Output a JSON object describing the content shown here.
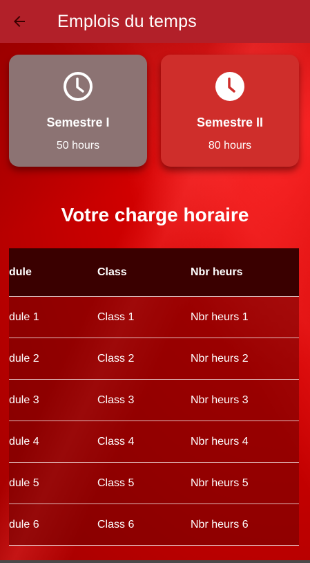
{
  "appbar": {
    "title": "Emplois du temps",
    "back_icon": "arrow-left-icon"
  },
  "cards": [
    {
      "name": "Semestre I",
      "hours": "50 hours",
      "icon": "clock-outline-icon",
      "color": "#8c7373"
    },
    {
      "name": "Semestre II",
      "hours": "80 hours",
      "icon": "clock-filled-icon",
      "color": "#cf2e2b"
    }
  ],
  "section_title": "Votre charge horaire",
  "table": {
    "headers": [
      "dule",
      "Class",
      "Nbr heurs"
    ],
    "rows": [
      [
        "dule 1",
        "Class 1",
        "Nbr heurs 1"
      ],
      [
        "dule 2",
        "Class 2",
        "Nbr heurs 2"
      ],
      [
        "dule 3",
        "Class 3",
        "Nbr heurs 3"
      ],
      [
        "dule 4",
        "Class 4",
        "Nbr heurs 4"
      ],
      [
        "dule 5",
        "Class 5",
        "Nbr heurs 5"
      ],
      [
        "dule 6",
        "Class 6",
        "Nbr heurs 6"
      ]
    ]
  },
  "colors": {
    "appbar": "#b22029",
    "background": "#c80000",
    "table_header": "#3a0000"
  }
}
